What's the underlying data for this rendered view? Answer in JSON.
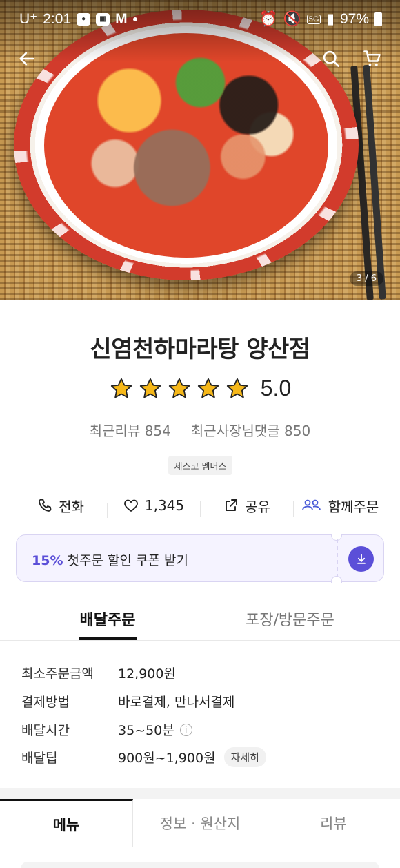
{
  "status_bar": {
    "carrier": "U⁺",
    "time": "2:01",
    "network": "5G",
    "battery": "97%"
  },
  "hero": {
    "page_counter": "3 / 6"
  },
  "shop": {
    "name": "신염천하마라탕 양산점",
    "rating": "5.0",
    "review_count_label": "최근리뷰 854",
    "owner_reply_label": "최근사장님댓글 850",
    "member_badge": "세스코 멤버스"
  },
  "actions": {
    "call": "전화",
    "likes": "1,345",
    "share": "공유",
    "group_order": "함께주문"
  },
  "coupon": {
    "percent": "15%",
    "text": "첫주문 할인 쿠폰 받기"
  },
  "order_tabs": {
    "delivery": "배달주문",
    "pickup": "포장/방문주문"
  },
  "info": {
    "min_order_label": "최소주문금액",
    "min_order_value": "12,900원",
    "payment_label": "결제방법",
    "payment_value": "바로결제, 만나서결제",
    "delivery_time_label": "배달시간",
    "delivery_time_value": "35~50분",
    "delivery_tip_label": "배달팁",
    "delivery_tip_value": "900원~1,900원",
    "detail_button": "자세히"
  },
  "main_tabs": {
    "menu": "메뉴",
    "info": "정보 · 원산지",
    "review": "리뷰"
  },
  "colors": {
    "accent": "#5b4fd8",
    "star": "#f6b81a"
  }
}
